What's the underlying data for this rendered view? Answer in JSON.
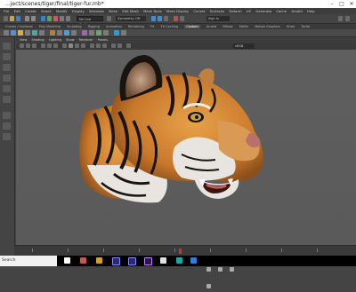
{
  "window": {
    "title": "...ject/scenes/tiger/final/tiger-fur.mb*",
    "controls": [
      "–",
      "□",
      "✕"
    ]
  },
  "menubar": {
    "items": [
      "File",
      "Edit",
      "Create",
      "Select",
      "Modify",
      "Display",
      "Windows",
      "Mesh",
      "Edit Mesh",
      "Mesh Tools",
      "Mesh Display",
      "Curves",
      "Surfaces",
      "Deform",
      "UV",
      "Generate",
      "Cache",
      "Arnold",
      "Help"
    ]
  },
  "status_line": {
    "selection_mask": "No Live Surface",
    "symmetry": "Symmetry: Off",
    "sign_in": "Sign In"
  },
  "shelf": {
    "tabs": [
      "Curves / Surfaces",
      "Poly Modeling",
      "Sculpting",
      "Rigging",
      "Animation",
      "Rendering",
      "FX",
      "FX Caching",
      "Custom",
      "Arnold",
      "Bifrost",
      "MASH",
      "Motion Graphics",
      "XGen",
      "Turtle"
    ],
    "active_tab": "Custom"
  },
  "viewport": {
    "menu": [
      "View",
      "Shading",
      "Lighting",
      "Show",
      "Renderer",
      "Panels"
    ],
    "gamma_field": "sRGB gamma"
  },
  "taskbar": {
    "search_text": "Search"
  },
  "colors": {
    "viewport_bg": "#5d5d5d",
    "tiger_orange": "#d98a2e",
    "tiger_white": "#e8e4df",
    "stripe": "#1a1410",
    "timeline_marker": "#cc3333"
  }
}
